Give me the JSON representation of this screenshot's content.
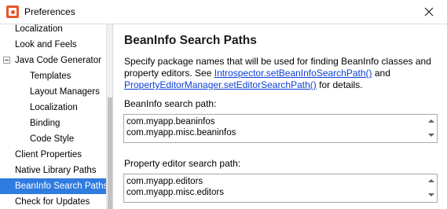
{
  "window": {
    "title": "Preferences",
    "icon": "app-logo-icon",
    "close_glyph": "✕"
  },
  "sidebar": {
    "items": [
      {
        "label": "Localization",
        "indent": 1,
        "selected": false
      },
      {
        "label": "Look and Feels",
        "indent": 1,
        "selected": false
      },
      {
        "label": "Java Code Generator",
        "indent": 1,
        "selected": false,
        "expander": "collapse-icon"
      },
      {
        "label": "Templates",
        "indent": 2,
        "selected": false
      },
      {
        "label": "Layout Managers",
        "indent": 2,
        "selected": false
      },
      {
        "label": "Localization",
        "indent": 2,
        "selected": false
      },
      {
        "label": "Binding",
        "indent": 2,
        "selected": false
      },
      {
        "label": "Code Style",
        "indent": 2,
        "selected": false
      },
      {
        "label": "Client Properties",
        "indent": 1,
        "selected": false
      },
      {
        "label": "Native Library Paths",
        "indent": 1,
        "selected": false
      },
      {
        "label": "BeanInfo Search Paths",
        "indent": 1,
        "selected": true
      },
      {
        "label": "Check for Updates",
        "indent": 1,
        "selected": false
      }
    ]
  },
  "content": {
    "heading": "BeanInfo Search Paths",
    "description": {
      "text1": "Specify package names that will be used for finding BeanInfo classes and property editors. See ",
      "link1": "Introspector.setBeanInfoSearchPath()",
      "text2": " and ",
      "link2": "PropertyEditorManager.setEditorSearchPath()",
      "text3": " for details."
    },
    "beaninfo_label": "BeanInfo search path:",
    "beaninfo_lines": [
      "com.myapp.beaninfos",
      "com.myapp.misc.beaninfos"
    ],
    "editor_label": "Property editor search path:",
    "editor_lines": [
      "com.myapp.editors",
      "com.myapp.misc.editors"
    ]
  },
  "colors": {
    "selection": "#2f7be0",
    "link": "#0b3fd6",
    "app_icon": "#e4572e"
  }
}
